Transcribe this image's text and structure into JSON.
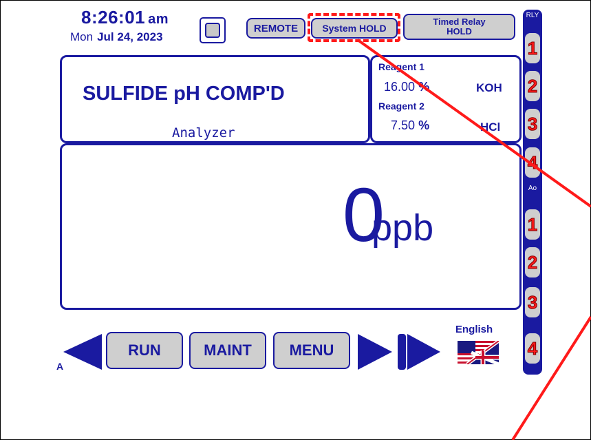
{
  "header": {
    "time": "8:26:01",
    "ampm": "am",
    "date_day": "Mon",
    "date_full": "Jul 24, 2023",
    "remote_label": "REMOTE",
    "system_hold_label": "System HOLD",
    "timed_relay_line1": "Timed Relay",
    "timed_relay_line2": "HOLD"
  },
  "analyzer": {
    "title": "SULFIDE pH COMP'D",
    "subtitle": "Analyzer"
  },
  "reagents": {
    "reagent1_label": "Reagent 1",
    "reagent1_value": "16.00",
    "reagent1_unit": "%",
    "reagent1_chem": "KOH",
    "reagent2_label": "Reagent 2",
    "reagent2_value": "7.50",
    "reagent2_unit": "%",
    "reagent2_chem": "HCl"
  },
  "reading": {
    "value": "0",
    "unit": "ppb"
  },
  "nav": {
    "run_label": "RUN",
    "maint_label": "MAINT",
    "menu_label": "MENU",
    "language_label": "English",
    "corner_label": "A"
  },
  "sidebar": {
    "rly_header": "RLY",
    "ao_header": "Ao",
    "relays": [
      "1",
      "2",
      "3",
      "4"
    ],
    "aos": [
      "1",
      "2",
      "3",
      "4"
    ]
  },
  "colors": {
    "primary_blue": "#1a1aa0",
    "button_gray": "#cfcfcf",
    "highlight_red": "#ff1a1a"
  }
}
